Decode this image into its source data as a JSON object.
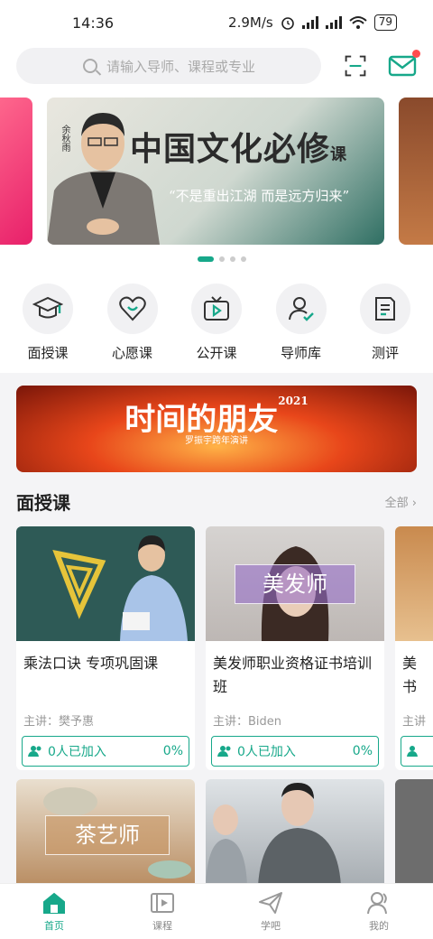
{
  "status": {
    "time": "14:36",
    "net_speed": "2.9M/s",
    "battery": "79"
  },
  "search": {
    "placeholder": "请输入导师、课程或专业"
  },
  "banner": {
    "title": "中国文化必修",
    "title_small": "课",
    "subtitle": "“不是重出江湖  而是远方归来”",
    "tag": "余秋雨"
  },
  "categories": [
    {
      "label": "面授课",
      "icon": "mortarboard-icon"
    },
    {
      "label": "心愿课",
      "icon": "heart-icon"
    },
    {
      "label": "公开课",
      "icon": "tv-play-icon"
    },
    {
      "label": "导师库",
      "icon": "teacher-check-icon"
    },
    {
      "label": "测评",
      "icon": "document-icon"
    }
  ],
  "ad": {
    "title": "时间的朋友",
    "year": "2021",
    "sub": "罗振宇跨年演讲"
  },
  "section": {
    "title": "面授课",
    "more": "全部 ›"
  },
  "courses": [
    {
      "title": "乘法口诀 专项巩固课",
      "teacher": "主讲：樊予惠",
      "joined": "0人已加入",
      "progress": "0%"
    },
    {
      "title": "美发师职业资格证书培训班",
      "teacher": "主讲：Biden",
      "joined": "0人已加入",
      "progress": "0%",
      "image_label": "美发师"
    },
    {
      "title": "美书",
      "teacher": "主讲",
      "joined": ""
    }
  ],
  "row2": [
    {
      "image_label": "茶艺师"
    },
    {
      "image_label": ""
    }
  ],
  "tabbar": [
    {
      "label": "首页",
      "icon": "home-icon",
      "active": true
    },
    {
      "label": "课程",
      "icon": "course-play-icon",
      "active": false
    },
    {
      "label": "学吧",
      "icon": "paper-plane-icon",
      "active": false
    },
    {
      "label": "我的",
      "icon": "profile-icon",
      "active": false
    }
  ],
  "colors": {
    "accent": "#17a88a",
    "badge": "#ff4d4f"
  }
}
